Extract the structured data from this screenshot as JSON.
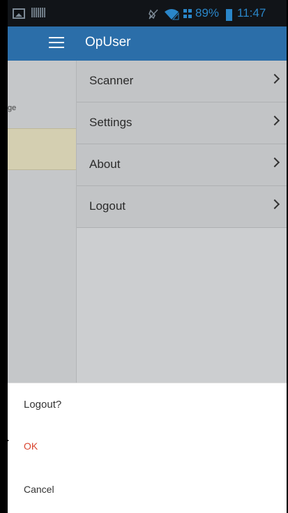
{
  "status_bar": {
    "battery_percent": "89%",
    "time": "11:47",
    "icons": [
      "image-icon",
      "barcode-icon",
      "mute-icon",
      "wifi-icon",
      "network-icon",
      "battery-icon"
    ],
    "color": "#2a86c9"
  },
  "app_bar": {
    "title": "OpUser",
    "menu_icon": "hamburger-menu-icon",
    "color": "#2b6ea9"
  },
  "underlay": {
    "partial_text": "ge"
  },
  "drawer": {
    "items": [
      {
        "label": "Scanner",
        "icon": "chevron-right-icon"
      },
      {
        "label": "Settings",
        "icon": "chevron-right-icon"
      },
      {
        "label": "About",
        "icon": "chevron-right-icon"
      },
      {
        "label": "Logout",
        "icon": "chevron-right-icon"
      }
    ]
  },
  "dialog": {
    "title": "Logout?",
    "ok_label": "OK",
    "cancel_label": "Cancel",
    "ok_color": "#d9452f"
  }
}
